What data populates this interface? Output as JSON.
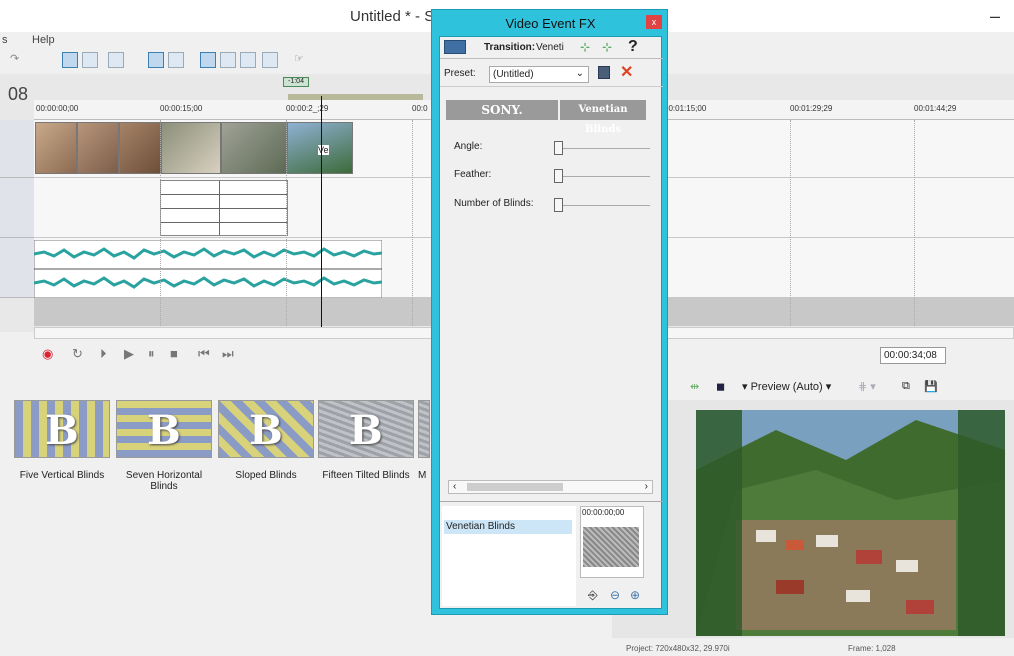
{
  "app": {
    "title": "Untitled * - S",
    "minimize_glyph": "–"
  },
  "menu": {
    "items": [
      "s",
      "Help"
    ]
  },
  "timeline": {
    "frame_counter": "08",
    "marker_label": "-1:04",
    "ruler_timecodes": [
      "00:00:00;00",
      "00:00:15;00",
      "00:00:2_;29",
      "00:0",
      "00:01:15;00",
      "00:01:29;29",
      "00:01:44;29"
    ],
    "clip_label": "Ve"
  },
  "transport": {
    "buttons": [
      "record-icon",
      "loop-icon",
      "play-from-start-icon",
      "play-icon",
      "pause-icon",
      "stop-icon",
      "prev-frame-icon",
      "next-frame-icon"
    ],
    "timecode": "00:00:34;08"
  },
  "transitions": [
    {
      "label": "Five Vertical Blinds",
      "style": "v"
    },
    {
      "label": "Seven Horizontal Blinds",
      "style": "h"
    },
    {
      "label": "Sloped Blinds",
      "style": "s"
    },
    {
      "label": "Fifteen Tilted Blinds",
      "style": "t"
    },
    {
      "label": "M",
      "style": "t"
    }
  ],
  "preview": {
    "mode_label": "Preview (Auto)"
  },
  "status": {
    "project": "Project:  720x480x32, 29.970i",
    "frame": "Frame:     1,028"
  },
  "fx_dialog": {
    "title": "Video Event FX",
    "close_glyph": "x",
    "transition_label": "Transition:",
    "transition_value": "Veneti",
    "help_glyph": "?",
    "preset_label": "Preset:",
    "preset_value": "(Untitled)",
    "tab_sony": "SONY.",
    "tab_effect": "Venetian Blinds",
    "params": [
      {
        "label": "Angle:",
        "value": 0
      },
      {
        "label": "Feather:",
        "value": 0
      },
      {
        "label": "Number of Blinds:",
        "value": 0
      }
    ],
    "list_item": "Venetian Blinds",
    "keyframe_time": "00:00:00;00"
  }
}
